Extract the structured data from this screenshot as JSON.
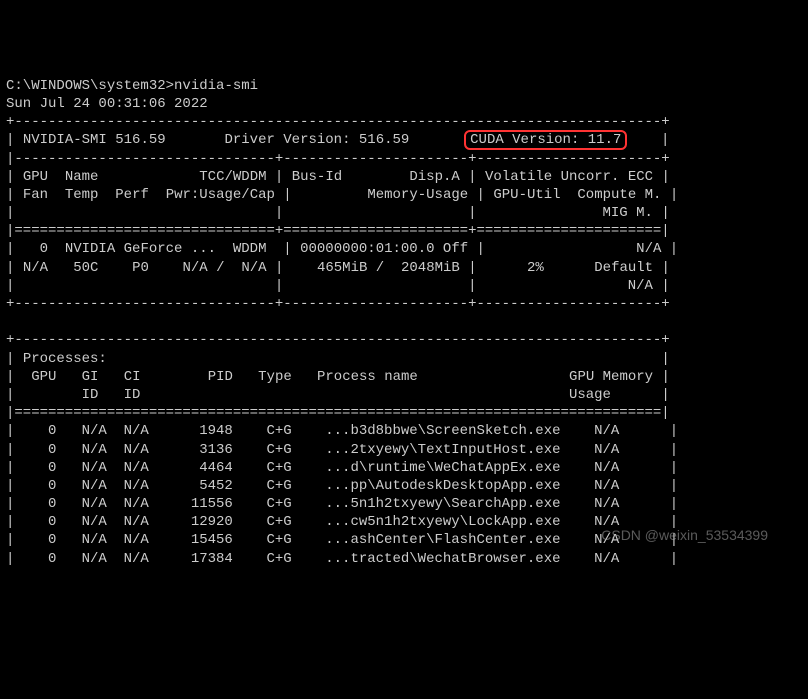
{
  "prompt_path": "C:\\WINDOWS\\system32>",
  "command": "nvidia-smi",
  "timestamp": "Sun Jul 24 00:31:06 2022",
  "smi_version_label": "NVIDIA-SMI",
  "smi_version": "516.59",
  "driver_label": "Driver Version:",
  "driver_version": "516.59",
  "cuda_label": "CUDA Version:",
  "cuda_version": "11.7",
  "hdr": {
    "gpu": "GPU",
    "name": "Name",
    "tcc_wddm": "TCC/WDDM",
    "fan": "Fan",
    "temp": "Temp",
    "perf": "Perf",
    "pwr": "Pwr:Usage/Cap",
    "busid": "Bus-Id",
    "dispa": "Disp.A",
    "memusage": "Memory-Usage",
    "volatile": "Volatile",
    "uncorr": "Uncorr. ECC",
    "gpuutil": "GPU-Util",
    "computem": "Compute M.",
    "migm": "MIG M."
  },
  "gpu_row": {
    "idx": "0",
    "name": "NVIDIA GeForce ...",
    "mode": "WDDM",
    "fan": "N/A",
    "temp": "50C",
    "perf": "P0",
    "pwr_usage": "N/A",
    "pwr_cap": "N/A",
    "busid": "00000000:01:00.0",
    "dispa": "Off",
    "mem_used": "465MiB",
    "mem_total": "2048MiB",
    "util": "2%",
    "ecc": "N/A",
    "compute": "Default",
    "mig": "N/A"
  },
  "proc_header": "Processes:",
  "proc_cols": {
    "gpu": "GPU",
    "gi": "GI",
    "ci": "CI",
    "id": "ID",
    "pid": "PID",
    "type": "Type",
    "pname": "Process name",
    "gmem": "GPU Memory",
    "usage": "Usage"
  },
  "processes": [
    {
      "gpu": "0",
      "gi": "N/A",
      "ci": "N/A",
      "pid": "1948",
      "type": "C+G",
      "name": "...b3d8bbwe\\ScreenSketch.exe",
      "mem": "N/A"
    },
    {
      "gpu": "0",
      "gi": "N/A",
      "ci": "N/A",
      "pid": "3136",
      "type": "C+G",
      "name": "...2txyewy\\TextInputHost.exe",
      "mem": "N/A"
    },
    {
      "gpu": "0",
      "gi": "N/A",
      "ci": "N/A",
      "pid": "4464",
      "type": "C+G",
      "name": "...d\\runtime\\WeChatAppEx.exe",
      "mem": "N/A"
    },
    {
      "gpu": "0",
      "gi": "N/A",
      "ci": "N/A",
      "pid": "5452",
      "type": "C+G",
      "name": "...pp\\AutodeskDesktopApp.exe",
      "mem": "N/A"
    },
    {
      "gpu": "0",
      "gi": "N/A",
      "ci": "N/A",
      "pid": "11556",
      "type": "C+G",
      "name": "...5n1h2txyewy\\SearchApp.exe",
      "mem": "N/A"
    },
    {
      "gpu": "0",
      "gi": "N/A",
      "ci": "N/A",
      "pid": "12920",
      "type": "C+G",
      "name": "...cw5n1h2txyewy\\LockApp.exe",
      "mem": "N/A"
    },
    {
      "gpu": "0",
      "gi": "N/A",
      "ci": "N/A",
      "pid": "15456",
      "type": "C+G",
      "name": "...ashCenter\\FlashCenter.exe",
      "mem": "N/A"
    },
    {
      "gpu": "0",
      "gi": "N/A",
      "ci": "N/A",
      "pid": "17384",
      "type": "C+G",
      "name": "...tracted\\WechatBrowser.exe",
      "mem": "N/A"
    }
  ],
  "watermark": "CSDN @weixin_53534399"
}
